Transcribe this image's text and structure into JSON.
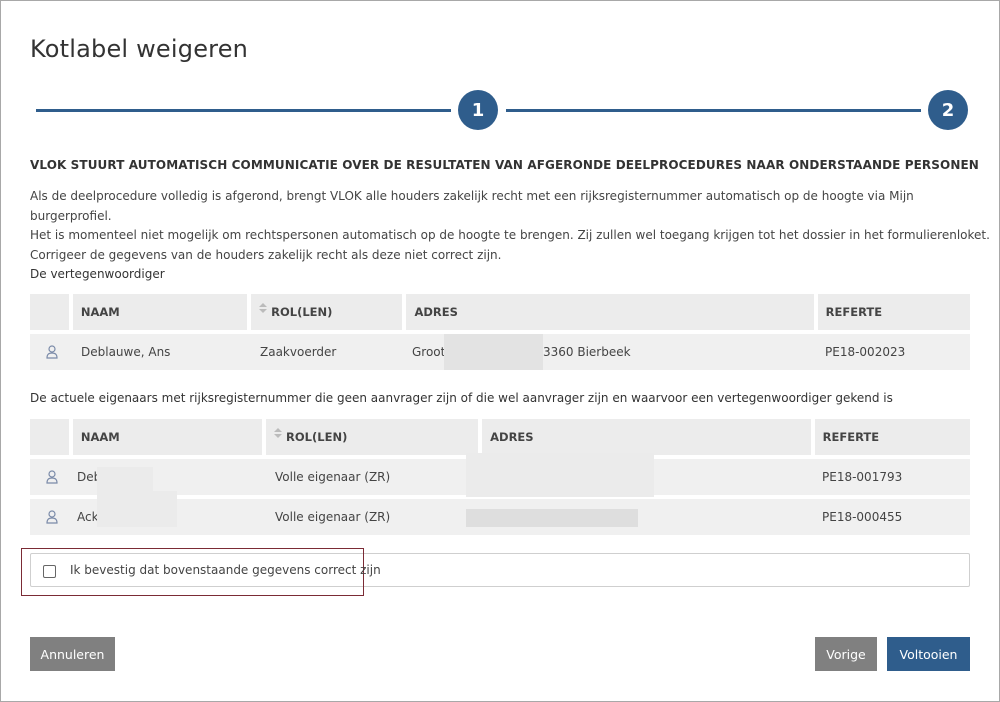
{
  "modal": {
    "title": "Kotlabel weigeren"
  },
  "stepper": {
    "steps": [
      "1",
      "2"
    ]
  },
  "info": {
    "heading": "VLOK STUURT AUTOMATISCH COMMUNICATIE OVER DE RESULTATEN VAN AFGERONDE DEELPROCEDURES NAAR ONDERSTAANDE PERSONEN",
    "lines": [
      "Als de deelprocedure volledig is afgerond, brengt VLOK alle houders zakelijk recht met een rijksregisternummer automatisch op de hoogte via Mijn burgerprofiel.",
      "Het is momenteel niet mogelijk om rechtspersonen automatisch op de hoogte te brengen. Zij zullen wel toegang krijgen tot het dossier in het formulierenloket.",
      "Corrigeer de gegevens van de houders zakelijk recht als deze niet correct zijn."
    ]
  },
  "representative": {
    "label": "De vertegenwoordiger",
    "columns": [
      "NAAM",
      "ROL(LEN)",
      "ADRES",
      "REFERTE"
    ],
    "rows": [
      {
        "name": "Deblauwe, Ans",
        "role": "Zaakvoerder",
        "address_start": "Groot",
        "address_end": "3360 Bierbeek",
        "reference": "PE18-002023"
      }
    ]
  },
  "owners": {
    "label": "De actuele eigenaars met rijksregisternummer die geen aanvrager zijn of die wel aanvrager zijn en waarvoor een vertegenwoordiger gekend is",
    "columns": [
      "NAAM",
      "ROL(LEN)",
      "ADRES",
      "REFERTE"
    ],
    "rows": [
      {
        "name": "Deb",
        "role": "Volle eigenaar (ZR)",
        "reference": "PE18-001793"
      },
      {
        "name": "Ack",
        "role": "Volle eigenaar (ZR)",
        "reference": "PE18-000455"
      }
    ]
  },
  "confirm": {
    "label": "Ik bevestig dat bovenstaande gegevens correct zijn",
    "checked": false
  },
  "buttons": {
    "cancel": "Annuleren",
    "previous": "Vorige",
    "finish": "Voltooien"
  },
  "colors": {
    "primary": "#2f5d8c",
    "secondary_button": "#808080",
    "highlight": "#7b2b35"
  }
}
